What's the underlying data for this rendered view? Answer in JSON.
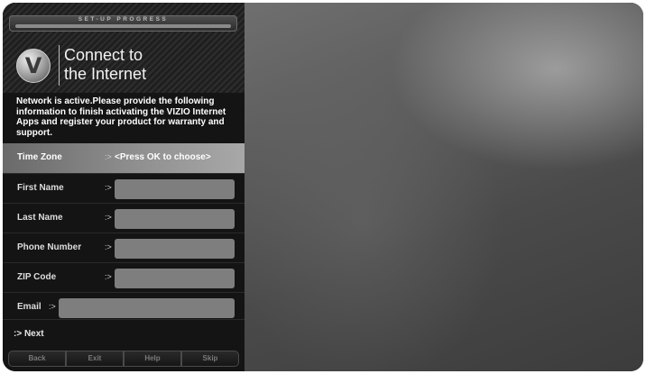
{
  "progress": {
    "label": "SET-UP PROGRESS"
  },
  "header": {
    "title_line1": "Connect to",
    "title_line2": "the Internet",
    "logo_letter": "V"
  },
  "intro_text": "Network is active.Please provide the following information to finish activating the VIZIO Internet Apps and register your product for warranty and support.",
  "arrow_glyph": ":>",
  "form": {
    "time_zone": {
      "label": "Time Zone",
      "value": "<Press OK to choose>"
    },
    "first_name": {
      "label": "First Name",
      "value": ""
    },
    "last_name": {
      "label": "Last Name",
      "value": ""
    },
    "phone_number": {
      "label": "Phone Number",
      "value": ""
    },
    "zip_code": {
      "label": "ZIP Code",
      "value": ""
    },
    "email": {
      "label": "Email",
      "value": ""
    }
  },
  "next_label": "Next",
  "buttons": {
    "back": "Back",
    "exit": "Exit",
    "help": "Help",
    "skip": "Skip"
  },
  "colors": {
    "panel_bg": "#141414",
    "highlight": "#8f8f8f",
    "field_bg": "#7e7e7e"
  }
}
